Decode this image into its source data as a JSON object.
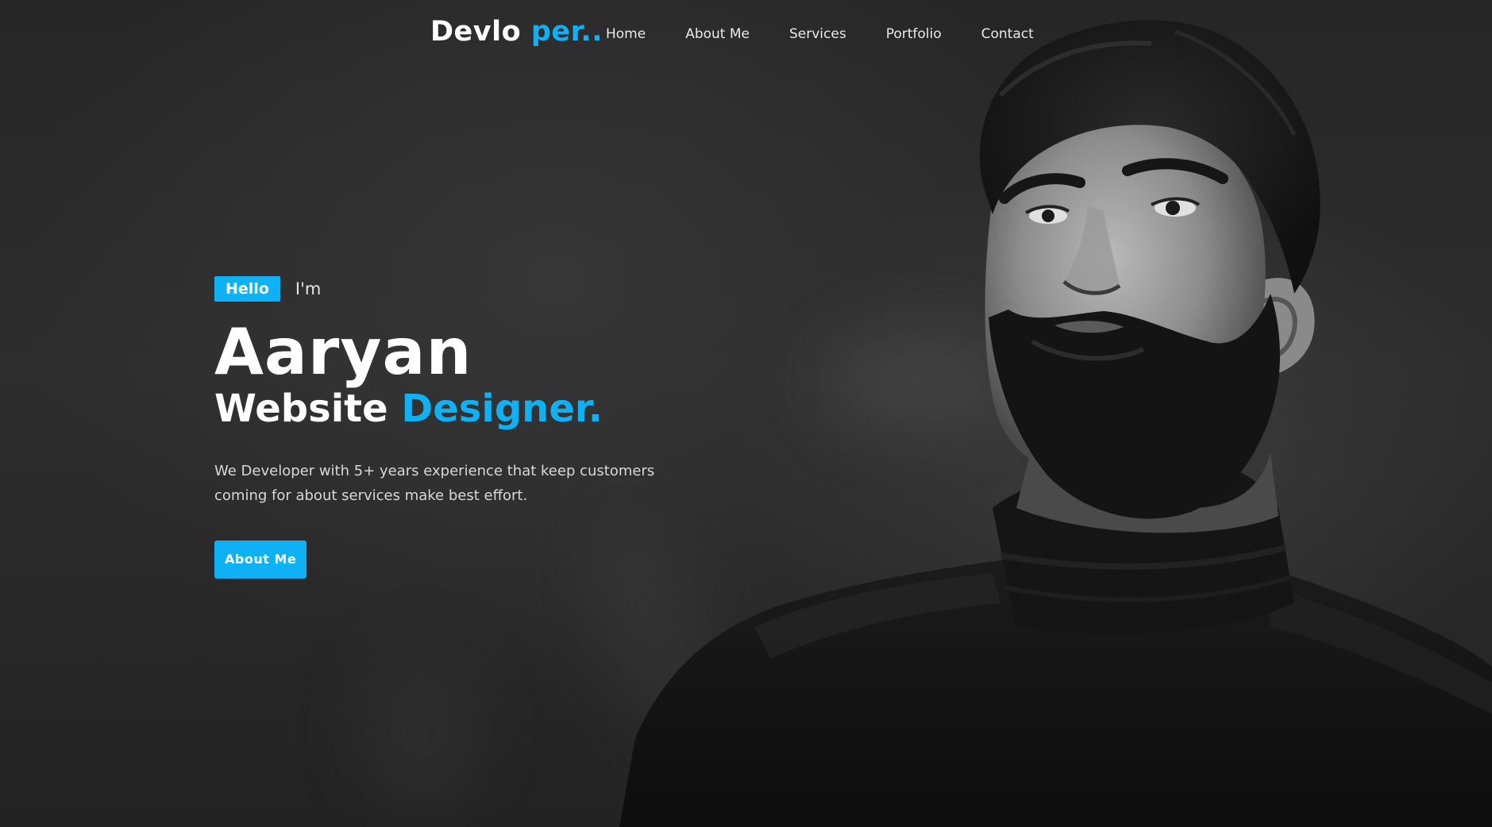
{
  "nav": {
    "logo_main": "Devlo ",
    "logo_accent": "per..",
    "links": [
      {
        "label": "Home"
      },
      {
        "label": "About Me"
      },
      {
        "label": "Services"
      },
      {
        "label": "Portfolio"
      },
      {
        "label": "Contact"
      }
    ]
  },
  "hero": {
    "badge": "Hello",
    "intro": "I'm",
    "name": "Aaryan",
    "role_main": "Website ",
    "role_accent": "Designer.",
    "description": "We Developer with 5+ years experience that keep customers coming for about services make best effort.",
    "button_label": "About Me"
  },
  "colors": {
    "accent": "#0fb1f5",
    "background": "#2a2a2a",
    "text": "#ffffff"
  }
}
